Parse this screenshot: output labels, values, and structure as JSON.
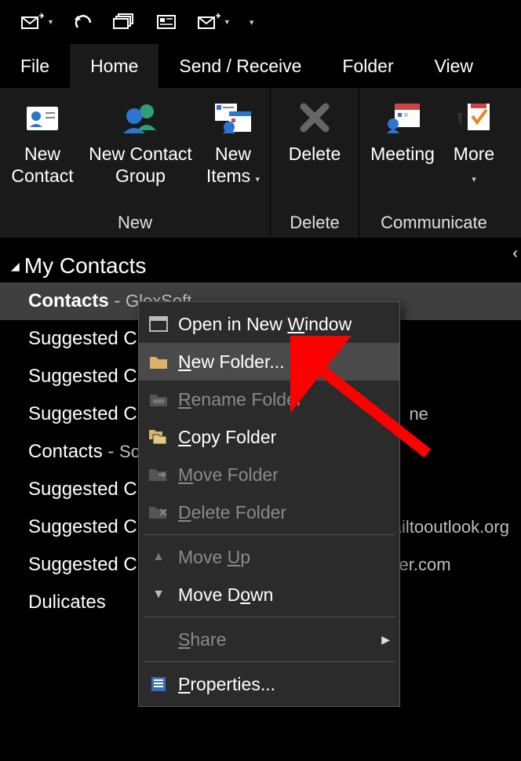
{
  "qat": {
    "items": [
      "send-receive-icon",
      "undo-icon",
      "stack-icon",
      "card-icon",
      "folder-icon",
      "overflow-icon"
    ]
  },
  "tabs": {
    "file": "File",
    "home": "Home",
    "send_receive": "Send / Receive",
    "folder": "Folder",
    "view": "View"
  },
  "ribbon": {
    "new_group": {
      "label": "New",
      "new_contact": "New Contact",
      "new_contact_group": "New Contact Group",
      "new_items": "New Items"
    },
    "delete_group": {
      "label": "Delete",
      "delete": "Delete"
    },
    "communicate_group": {
      "label": "Communicate",
      "meeting": "Meeting",
      "more": "More"
    }
  },
  "nav": {
    "header": "My Contacts",
    "items": [
      {
        "main": "Contacts",
        "bold": true,
        "suffix": "GlexSoft",
        "selected": true
      },
      {
        "main": "Suggested C"
      },
      {
        "main": "Suggested C"
      },
      {
        "main": "Suggested C",
        "suffix_tail": "ne"
      },
      {
        "main": "Contacts",
        "suffix": "Sot"
      },
      {
        "main": "Suggested C"
      },
      {
        "main": "Suggested C",
        "suffix_tail": "mailtooutlook.org"
      },
      {
        "main": "Suggested C",
        "suffix_tail": "sfer.com"
      },
      {
        "main": "Dulicates"
      }
    ]
  },
  "context_menu": {
    "open_new_window": {
      "pre": "Open in New ",
      "ul": "W",
      "post": "indow"
    },
    "new_folder": {
      "ul": "N",
      "post": "ew Folder..."
    },
    "rename_folder": {
      "ul": "R",
      "post": "ename Folder"
    },
    "copy_folder": {
      "ul": "C",
      "post": "opy Folder"
    },
    "move_folder": {
      "ul": "M",
      "post": "ove Folder"
    },
    "delete_folder": {
      "ul": "D",
      "post": "elete Folder"
    },
    "move_up": {
      "pre": "Move ",
      "ul": "U",
      "post": "p"
    },
    "move_down": {
      "pre": "Move D",
      "ul": "o",
      "post": "wn"
    },
    "share": {
      "ul": "S",
      "post": "hare"
    },
    "properties": {
      "ul": "P",
      "post": "roperties..."
    }
  }
}
